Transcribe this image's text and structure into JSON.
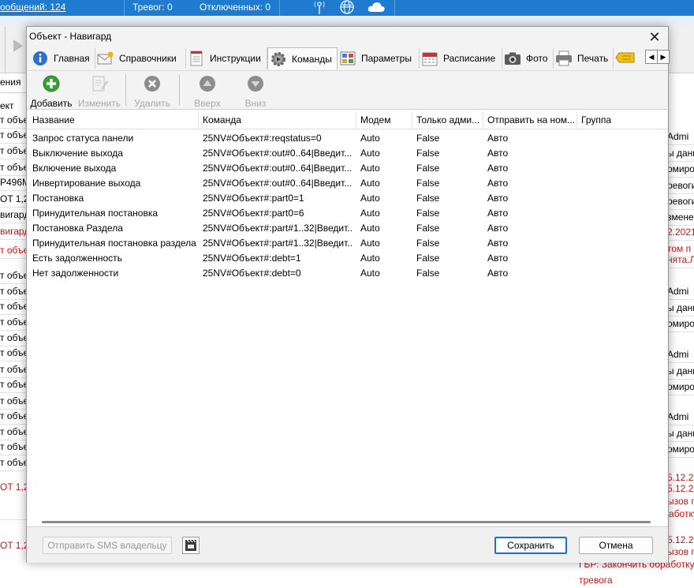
{
  "background": {
    "top_bar": {
      "messages": "ообщений: 124",
      "alarms": "Тревог: 0",
      "disconnected": "Отключенных: 0"
    },
    "grid_header_left": "ения",
    "grid_header_left2": "ект",
    "left_rows": [
      {
        "text": "т объе",
        "red": false
      },
      {
        "text": "т объе",
        "red": false
      },
      {
        "text": "т объе",
        "red": false
      },
      {
        "text": "т объе",
        "red": false
      },
      {
        "text": "P496M",
        "red": false
      },
      {
        "text": "OT 1,2 б",
        "red": false
      },
      {
        "text": "вигард",
        "red": false
      },
      {
        "text": "вигард",
        "red": true
      },
      {
        "text": "т объе",
        "red": true
      },
      {
        "text": "т объе",
        "red": false
      },
      {
        "text": "т объе",
        "red": false
      },
      {
        "text": "т объе",
        "red": false
      },
      {
        "text": "т объе",
        "red": false
      },
      {
        "text": "т объе",
        "red": false
      },
      {
        "text": "т объе",
        "red": false
      },
      {
        "text": "т объе",
        "red": false
      },
      {
        "text": "т объе",
        "red": false
      },
      {
        "text": "т объе",
        "red": false
      },
      {
        "text": "т объе",
        "red": false
      },
      {
        "text": "т объе",
        "red": false
      },
      {
        "text": "т объе",
        "red": false
      },
      {
        "text": "т объе",
        "red": false
      }
    ],
    "left_bottom_1": "OT 1,2 б",
    "left_bottom_2": "OT 1,2 б",
    "right_rows": [
      {
        "text": "Admi",
        "red": false
      },
      {
        "text": "ы данн",
        "red": false
      },
      {
        "text": "омиро",
        "red": false
      },
      {
        "text": "ревоги",
        "red": false
      },
      {
        "text": "ревоги",
        "red": false
      },
      {
        "text": "зменен",
        "red": false
      },
      {
        "text": "2.2021",
        "red": true
      },
      {
        "text": "том п",
        "red": true
      },
      {
        "text": "нята.Л",
        "red": true
      },
      {
        "text": "Admi",
        "red": false
      },
      {
        "text": "ы данн",
        "red": false
      },
      {
        "text": "омиро",
        "red": false
      },
      {
        "text": "Admi",
        "red": false
      },
      {
        "text": "ы данн",
        "red": false
      },
      {
        "text": "омиро",
        "red": false
      },
      {
        "text": "Admi",
        "red": false
      },
      {
        "text": "ы данн",
        "red": false
      },
      {
        "text": "омиро",
        "red": false
      }
    ],
    "right_red_text": [
      "5.12.20",
      "5.12.20",
      "ызов п",
      "аботку",
      "5.12.20",
      "ызов п",
      "ГБР: Закончить обработку",
      "тревога"
    ]
  },
  "dialog": {
    "title": "Объект - Навигард",
    "tabs": [
      {
        "label": "Главная",
        "icon": "info-icon"
      },
      {
        "label": "Справочники",
        "icon": "envelope-icon"
      },
      {
        "label": "Инструкции",
        "icon": "document-icon"
      },
      {
        "label": "Команды",
        "icon": "gear-icon",
        "active": true
      },
      {
        "label": "Параметры",
        "icon": "parameters-icon"
      },
      {
        "label": "Расписание",
        "icon": "calendar-icon"
      },
      {
        "label": "Фото",
        "icon": "camera-icon"
      },
      {
        "label": "Печать",
        "icon": "printer-icon"
      }
    ],
    "toolbar": {
      "add": "Добавить",
      "edit": "Изменить",
      "delete": "Удалить",
      "up": "Вверх",
      "down": "Вниз"
    },
    "columns": [
      "Название",
      "Команда",
      "Модем",
      "Только адми...",
      "Отправить на ном...",
      "Группа"
    ],
    "rows": [
      [
        "Запрос статуса панели",
        "25NV#Объект#:reqstatus=0",
        "Auto",
        "False",
        "Авто",
        ""
      ],
      [
        "Выключение выхода",
        "25NV#Объект#:out#0..64|Введит...",
        "Auto",
        "False",
        "Авто",
        ""
      ],
      [
        "Включение выхода",
        "25NV#Объект#:out#0..64|Введит...",
        "Auto",
        "False",
        "Авто",
        ""
      ],
      [
        "Инвертирование выхода",
        "25NV#Объект#:out#0..64|Введит...",
        "Auto",
        "False",
        "Авто",
        ""
      ],
      [
        "Постановка",
        "25NV#Объект#:part0=1",
        "Auto",
        "False",
        "Авто",
        ""
      ],
      [
        "Принудительная постановка",
        "25NV#Объект#:part0=6",
        "Auto",
        "False",
        "Авто",
        ""
      ],
      [
        "Постановка Раздела",
        "25NV#Объект#:part#1..32|Введит...",
        "Auto",
        "False",
        "Авто",
        ""
      ],
      [
        "Принудительная постановка раздела",
        "25NV#Объект#:part#1..32|Введит...",
        "Auto",
        "False",
        "Авто",
        ""
      ],
      [
        "Есть задолженность",
        "25NV#Объект#:debt=1",
        "Auto",
        "False",
        "Авто",
        ""
      ],
      [
        "Нет задолженности",
        "25NV#Объект#:debt=0",
        "Auto",
        "False",
        "Авто",
        ""
      ]
    ],
    "footer": {
      "sms": "Отправить SMS владельцу",
      "save": "Сохранить",
      "cancel": "Отмена"
    }
  }
}
